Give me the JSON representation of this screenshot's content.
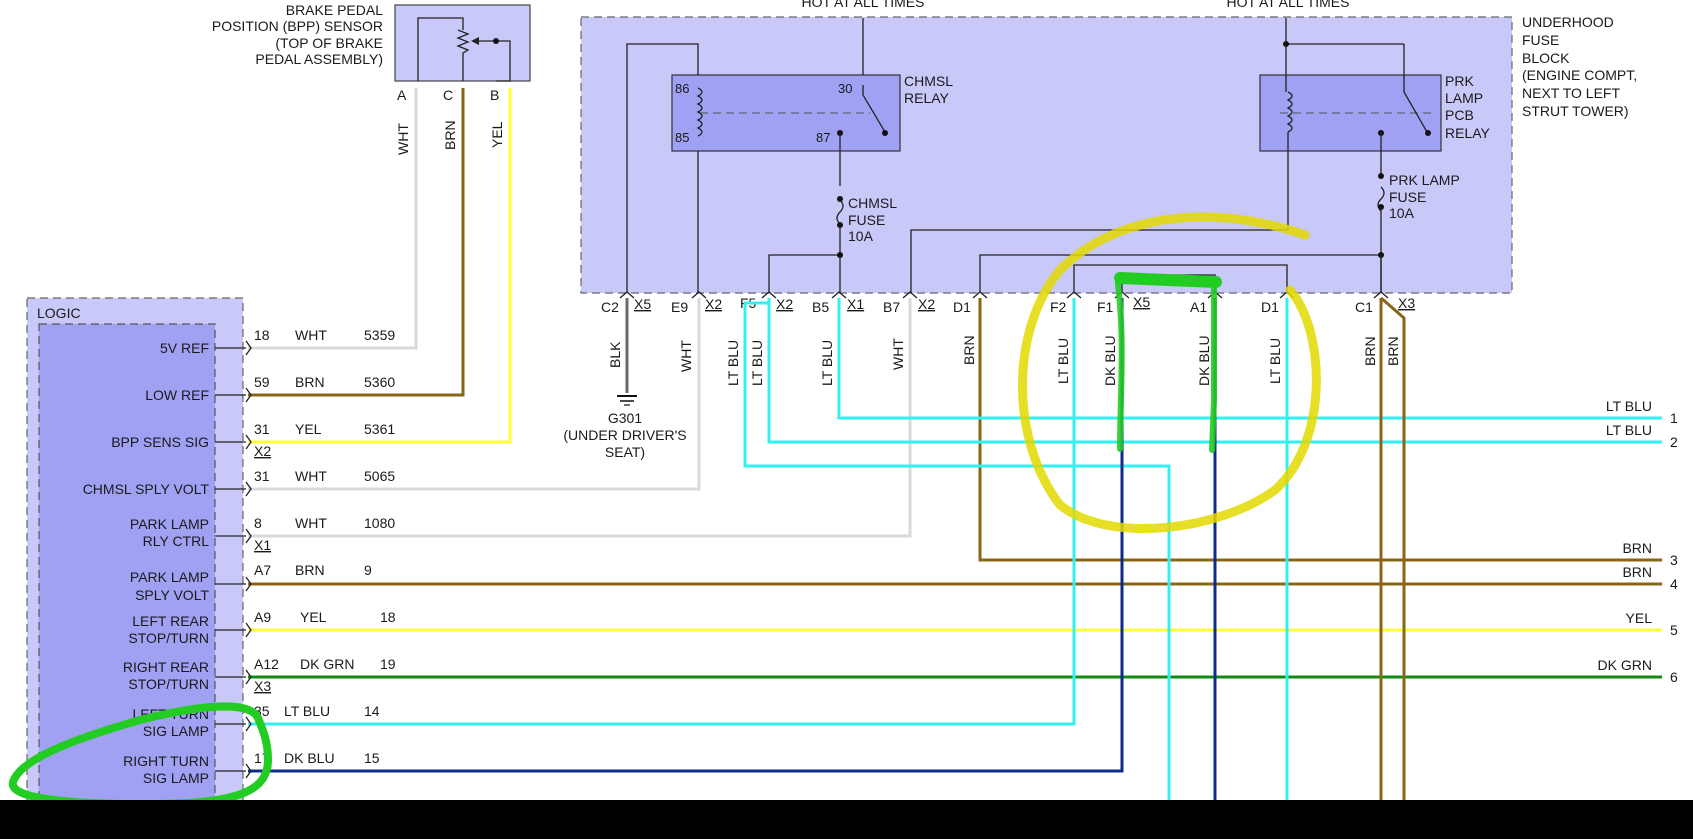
{
  "sensor": {
    "title_lines": [
      "BRAKE PEDAL",
      "POSITION (BPP) SENSOR",
      "(TOP OF BRAKE",
      "PEDAL ASSEMBLY)"
    ],
    "pins": [
      "A",
      "C",
      "B"
    ],
    "wires": [
      "WHT",
      "BRN",
      "YEL"
    ]
  },
  "top_labels": [
    "HOT AT ALL TIMES",
    "HOT AT ALL TIMES"
  ],
  "fuse_block": {
    "title_lines": [
      "UNDERHOOD",
      "FUSE",
      "BLOCK",
      "(ENGINE COMPT,",
      "NEXT TO LEFT",
      "STRUT TOWER)"
    ],
    "relay1": {
      "label_lines": [
        "CHMSL",
        "RELAY"
      ],
      "pins": [
        "86",
        "85",
        "30",
        "87"
      ]
    },
    "relay2": {
      "label_lines": [
        "PRK",
        "LAMP",
        "PCB",
        "RELAY"
      ]
    },
    "fuse1": {
      "label_lines": [
        "CHMSL",
        "FUSE",
        "10A"
      ]
    },
    "fuse2": {
      "label_lines": [
        "PRK LAMP",
        "FUSE",
        "10A"
      ]
    },
    "connectors": [
      {
        "pin": "C2",
        "conn": "X5"
      },
      {
        "pin": "E9",
        "conn": "X2"
      },
      {
        "pin": "F5",
        "conn": "X2"
      },
      {
        "pin": "B5",
        "conn": "X1"
      },
      {
        "pin": "B7",
        "conn": "X2"
      },
      {
        "pin": "D1",
        "conn": ""
      },
      {
        "pin": "F2",
        "conn": ""
      },
      {
        "pin": "F1",
        "conn": "X5"
      },
      {
        "pin": "A1",
        "conn": ""
      },
      {
        "pin": "D1",
        "conn": ""
      },
      {
        "pin": "C1",
        "conn": "X3"
      }
    ],
    "drop_wires": [
      "BLK",
      "WHT",
      "LT BLU",
      "LT BLU",
      "LT BLU",
      "WHT",
      "BRN",
      "LT BLU",
      "DK BLU",
      "DK BLU",
      "LT BLU",
      "BRN",
      "BRN"
    ]
  },
  "ground": {
    "label_lines": [
      "G301",
      "(UNDER DRIVER'S",
      "SEAT)"
    ]
  },
  "logic": {
    "title": "LOGIC",
    "rows": [
      {
        "label_lines": [
          "5V REF"
        ],
        "pin": "18",
        "color": "WHT",
        "circuit": "5359",
        "conn": ""
      },
      {
        "label_lines": [
          "LOW REF"
        ],
        "pin": "59",
        "color": "BRN",
        "circuit": "5360",
        "conn": ""
      },
      {
        "label_lines": [
          "BPP SENS SIG"
        ],
        "pin": "31",
        "color": "YEL",
        "circuit": "5361",
        "conn": "X2"
      },
      {
        "label_lines": [
          "CHMSL SPLY VOLT"
        ],
        "pin": "31",
        "color": "WHT",
        "circuit": "5065",
        "conn": ""
      },
      {
        "label_lines": [
          "PARK LAMP",
          "RLY CTRL"
        ],
        "pin": "8",
        "color": "WHT",
        "circuit": "1080",
        "conn": "X1"
      },
      {
        "label_lines": [
          "PARK LAMP",
          "SPLY VOLT"
        ],
        "pin": "A7",
        "color": "BRN",
        "circuit": "9",
        "conn": ""
      },
      {
        "label_lines": [
          "LEFT REAR",
          "STOP/TURN"
        ],
        "pin": "A9",
        "color": "YEL",
        "circuit": "18",
        "conn": ""
      },
      {
        "label_lines": [
          "RIGHT REAR",
          "STOP/TURN"
        ],
        "pin": "A12",
        "color": "DK GRN",
        "circuit": "19",
        "conn": "X3"
      },
      {
        "label_lines": [
          "LEFT TURN",
          "SIG LAMP"
        ],
        "pin": "35",
        "color": "LT BLU",
        "circuit": "14",
        "conn": ""
      },
      {
        "label_lines": [
          "RIGHT TURN",
          "SIG LAMP"
        ],
        "pin": "17",
        "color": "DK BLU",
        "circuit": "15",
        "conn": ""
      }
    ]
  },
  "right_outputs": [
    {
      "color": "LT BLU",
      "num": "1"
    },
    {
      "color": "LT BLU",
      "num": "2"
    },
    {
      "color": "BRN",
      "num": "3"
    },
    {
      "color": "BRN",
      "num": "4"
    },
    {
      "color": "YEL",
      "num": "5"
    },
    {
      "color": "DK GRN",
      "num": "6"
    }
  ],
  "colors": {
    "wht": "#d9d9d9",
    "brn": "#8a6516",
    "yel": "#ffff33",
    "ltblu": "#33f0f0",
    "dkblu": "#0d2a8c",
    "dkgrn": "#138a13",
    "blk": "#6a6a6a",
    "highlight_yellow": "#e3d800",
    "highlight_green": "#22cc22"
  }
}
